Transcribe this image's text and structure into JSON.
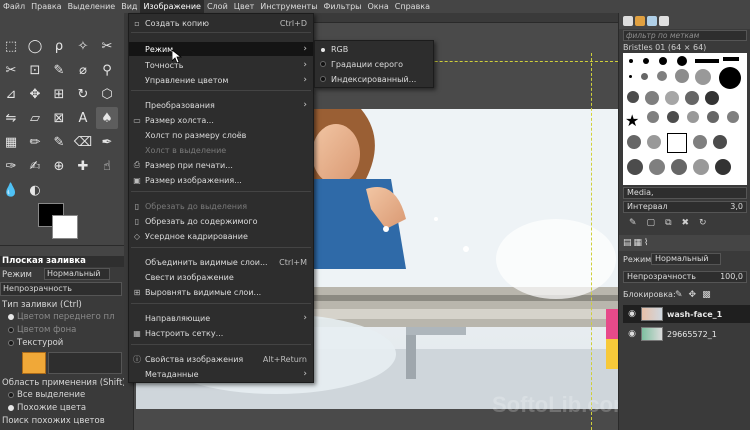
{
  "menubar": {
    "items": [
      "Файл",
      "Правка",
      "Выделение",
      "Вид",
      "Изображение",
      "Слой",
      "Цвет",
      "Инструменты",
      "Фильтры",
      "Окна",
      "Справка"
    ],
    "active_index": 4
  },
  "tool_options": {
    "title": "Плоская заливка",
    "mode_label": "Режим",
    "mode_value": "Нормальный",
    "opacity_label": "Непрозрачность",
    "fill_type_label": "Тип заливки (Ctrl)",
    "fill_fg": "Цветом переднего пл",
    "fill_bg": "Цветом фона",
    "fill_pattern": "Текстурой",
    "area_label": "Область применения (Shift)",
    "area_selection": "Все выделение",
    "area_similar": "Похожие цвета",
    "find_similar": "Поиск похожих цветов"
  },
  "image_menu": {
    "items": [
      {
        "label": "Создать копию",
        "accel": "Ctrl+D",
        "icon": "▫"
      },
      {
        "label": "Режим",
        "submenu": true,
        "highlight": true
      },
      {
        "label": "Точность",
        "submenu": true
      },
      {
        "label": "Управление цветом",
        "submenu": true
      },
      {
        "label": "Преобразования",
        "submenu": true
      },
      {
        "label": "Размер холста...",
        "icon": "▭"
      },
      {
        "label": "Холст по размеру слоёв"
      },
      {
        "label": "Холст в выделение",
        "disabled": true
      },
      {
        "label": "Размер при печати...",
        "icon": "⎙"
      },
      {
        "label": "Размер изображения...",
        "icon": "▣"
      },
      {
        "label": "Обрезать до выделения",
        "disabled": true,
        "icon": "▯"
      },
      {
        "label": "Обрезать до содержимого",
        "icon": "▯"
      },
      {
        "label": "Усердное кадрирование",
        "icon": "◇"
      },
      {
        "label": "Объединить видимые слои...",
        "accel": "Ctrl+M"
      },
      {
        "label": "Свести изображение"
      },
      {
        "label": "Выровнять видимые слои...",
        "icon": "⊞"
      },
      {
        "label": "Направляющие",
        "submenu": true
      },
      {
        "label": "Настроить сетку...",
        "icon": "▦"
      },
      {
        "label": "Свойства изображения",
        "accel": "Alt+Return",
        "icon": "ⓘ"
      },
      {
        "label": "Метаданные",
        "submenu": true
      }
    ]
  },
  "mode_submenu": {
    "items": [
      {
        "label": "RGB",
        "checked": true
      },
      {
        "label": "Градации серого",
        "checked": false
      },
      {
        "label": "Индексированный...",
        "checked": false
      }
    ]
  },
  "brushes": {
    "filter_placeholder": "фильтр по меткам",
    "current": "Bristles 01 (64 × 64)",
    "tag": "Media,",
    "spacing_label": "Интервал",
    "spacing_value": "3,0"
  },
  "layers": {
    "mode_label": "Режим",
    "mode_value": "Нормальный",
    "opacity_label": "Непрозрачность",
    "opacity_value": "100,0",
    "lock_label": "Блокировка:",
    "items": [
      {
        "name": "wash-face_1",
        "selected": true
      },
      {
        "name": "29665572_1",
        "selected": false
      }
    ]
  },
  "watermark": "SoftoLib.com",
  "colors": {
    "accent_fg": "#000000",
    "accent_bg": "#ffffff",
    "menu_bg": "#2d2d2d",
    "panel_bg": "#3a3a3a"
  }
}
